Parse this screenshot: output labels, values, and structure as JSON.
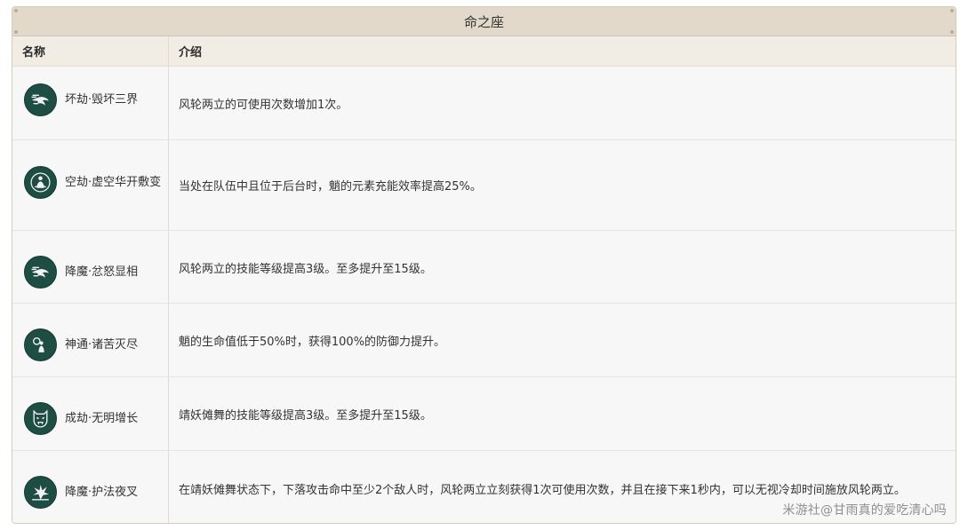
{
  "table": {
    "title": "命之座",
    "headers": {
      "name": "名称",
      "desc": "介绍"
    },
    "rows": [
      {
        "name": "坏劫·毁坏三界",
        "desc": "风轮两立的可使用次数增加1次。",
        "icon": "wind-dash-icon"
      },
      {
        "name": "空劫·虚空华开敷变",
        "desc": "当处在队伍中且位于后台时，魈的元素充能效率提高25%。",
        "icon": "meditating-figure-icon"
      },
      {
        "name": "降魔·忿怒显相",
        "desc": "风轮两立的技能等级提高3级。至多提升至15级。",
        "icon": "wind-dash-icon"
      },
      {
        "name": "神通·诸苦灭尽",
        "desc": "魈的生命值低于50%时，获得100%的防御力提升。",
        "icon": "figure-swirl-icon"
      },
      {
        "name": "成劫·无明增长",
        "desc": "靖妖傩舞的技能等级提高3级。至多提升至15级。",
        "icon": "demon-mask-icon"
      },
      {
        "name": "降魔·护法夜叉",
        "desc": "在靖妖傩舞状态下，下落攻击命中至少2个敌人时，风轮两立立刻获得1次可使用次数，并且在接下来1秒内，可以无视冷却时间施放风轮两立。",
        "icon": "impact-burst-icon"
      }
    ]
  },
  "watermark": "米游社@甘雨真的爱吃清心吗",
  "colors": {
    "title_bg": "#e2d9cb",
    "header_bg": "#f1ece4",
    "row_bg": "#f7f7f7",
    "icon_bg": "#1e4d43"
  }
}
